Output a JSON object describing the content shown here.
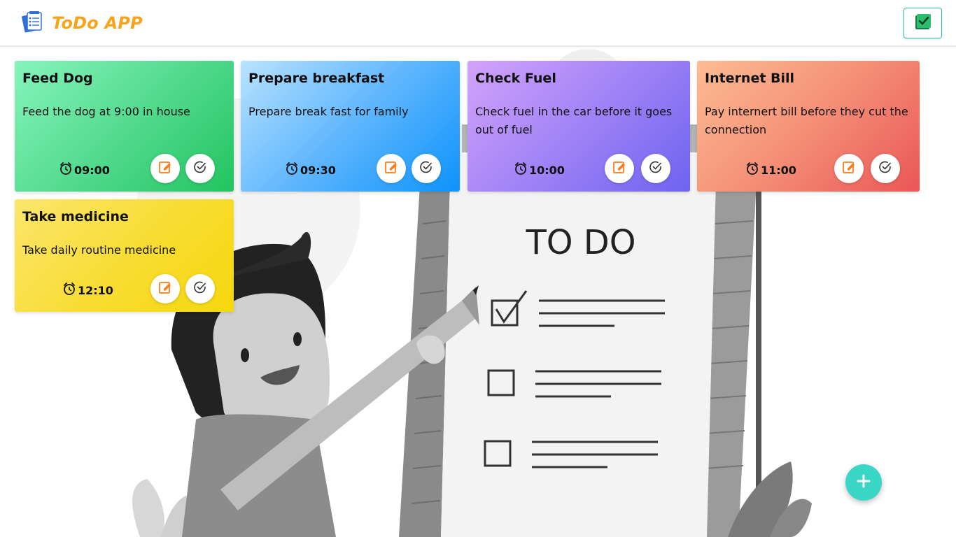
{
  "app": {
    "title": "ToDo APP"
  },
  "colors": {
    "brand": "#f7a41d",
    "accent": "#2bbda7",
    "fab": "#3ad7c6",
    "edit_icon": "#ff7b1c"
  },
  "illustration": {
    "heading": "TO DO"
  },
  "tasks": [
    {
      "title": "Feed Dog",
      "description": "Feed the dog at 9:00 in house",
      "time": "09:00"
    },
    {
      "title": "Prepare breakfast",
      "description": "Prepare break fast for family",
      "time": "09:30"
    },
    {
      "title": "Check Fuel",
      "description": "Check fuel in the car before it goes out of fuel",
      "time": "10:00"
    },
    {
      "title": "Internet Bill",
      "description": "Pay internert bill before they cut the connection",
      "time": "11:00"
    },
    {
      "title": "Take medicine",
      "description": "Take daily routine medicine",
      "time": "12:10"
    }
  ],
  "icons": {
    "logo": "notepad-icon",
    "header_button": "checkbox-icon",
    "time": "alarm-clock-icon",
    "edit": "edit-icon",
    "complete": "check-circle-icon",
    "add": "plus-icon"
  }
}
